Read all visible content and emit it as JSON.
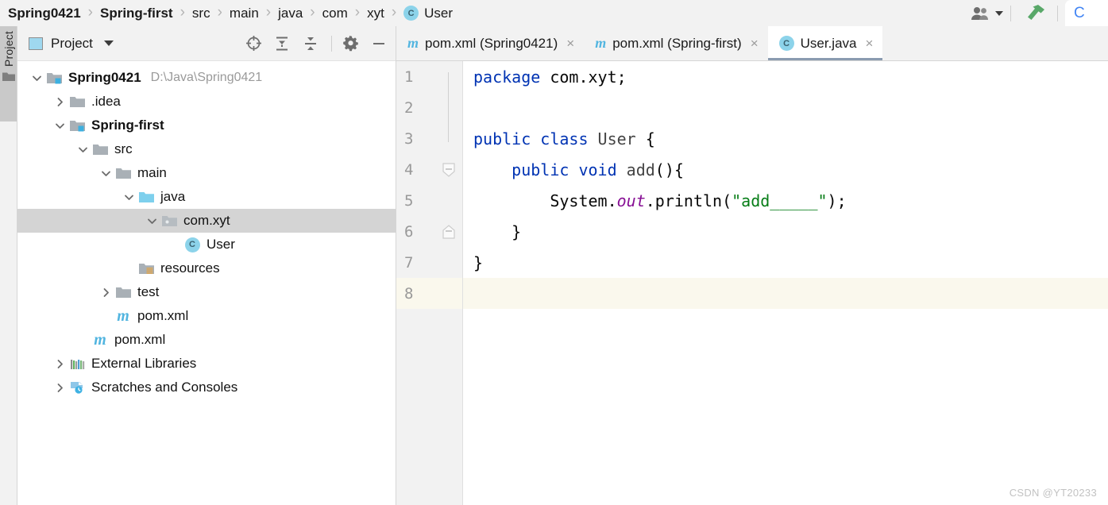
{
  "topbar": {
    "breadcrumb": [
      {
        "label": "Spring0421",
        "bold": true,
        "icon": null
      },
      {
        "label": "Spring-first",
        "bold": true,
        "icon": null
      },
      {
        "label": "src",
        "bold": false,
        "icon": null
      },
      {
        "label": "main",
        "bold": false,
        "icon": null
      },
      {
        "label": "java",
        "bold": false,
        "icon": null
      },
      {
        "label": "com",
        "bold": false,
        "icon": null
      },
      {
        "label": "xyt",
        "bold": false,
        "icon": null
      },
      {
        "label": "User",
        "bold": false,
        "icon": "class-icon",
        "icon_letter": "C"
      }
    ],
    "separator": "›",
    "people_icon": "people-icon",
    "dropdown_icon": "chevron-down-icon",
    "build_icon": "hammer-icon",
    "browser_letter": "C"
  },
  "stripe": {
    "label": "Project",
    "icon": "folder-icon"
  },
  "project_panel": {
    "title": "Project",
    "title_icon": "project-window-icon",
    "dropdown_icon": "chevron-down-icon",
    "tools": [
      {
        "name": "locate-icon",
        "tooltip": "Select Opened File"
      },
      {
        "name": "expand-all-icon",
        "tooltip": "Expand All"
      },
      {
        "name": "collapse-all-icon",
        "tooltip": "Collapse All"
      },
      {
        "name": "settings-gear-icon",
        "tooltip": "Settings"
      },
      {
        "name": "hide-icon",
        "tooltip": "Hide"
      }
    ],
    "tree": [
      {
        "label": "Spring0421",
        "path": "D:\\Java\\Spring0421",
        "indent": 0,
        "arrow": "down",
        "icon": "module-folder-icon",
        "bold": true,
        "selected": false
      },
      {
        "label": ".idea",
        "path": "",
        "indent": 1,
        "arrow": "right",
        "icon": "folder-icon",
        "bold": false,
        "selected": false
      },
      {
        "label": "Spring-first",
        "path": "",
        "indent": 1,
        "arrow": "down",
        "icon": "module-folder-icon",
        "bold": true,
        "selected": false
      },
      {
        "label": "src",
        "path": "",
        "indent": 2,
        "arrow": "down",
        "icon": "folder-icon",
        "bold": false,
        "selected": false
      },
      {
        "label": "main",
        "path": "",
        "indent": 3,
        "arrow": "down",
        "icon": "folder-icon",
        "bold": false,
        "selected": false
      },
      {
        "label": "java",
        "path": "",
        "indent": 4,
        "arrow": "down",
        "icon": "source-root-icon",
        "bold": false,
        "selected": false
      },
      {
        "label": "com.xyt",
        "path": "",
        "indent": 5,
        "arrow": "down",
        "icon": "package-icon",
        "bold": false,
        "selected": true
      },
      {
        "label": "User",
        "path": "",
        "indent": 6,
        "arrow": "none",
        "icon": "class-icon",
        "bold": false,
        "selected": false
      },
      {
        "label": "resources",
        "path": "",
        "indent": 4,
        "arrow": "none",
        "icon": "resources-folder-icon",
        "bold": false,
        "selected": false
      },
      {
        "label": "test",
        "path": "",
        "indent": 3,
        "arrow": "right",
        "icon": "folder-icon",
        "bold": false,
        "selected": false
      },
      {
        "label": "pom.xml",
        "path": "",
        "indent": 3,
        "arrow": "none",
        "icon": "maven-icon",
        "bold": false,
        "selected": false
      },
      {
        "label": "pom.xml",
        "path": "",
        "indent": 2,
        "arrow": "none",
        "icon": "maven-icon",
        "bold": false,
        "selected": false
      },
      {
        "label": "External Libraries",
        "path": "",
        "indent": 1,
        "arrow": "right",
        "icon": "libraries-icon",
        "bold": false,
        "selected": false
      },
      {
        "label": "Scratches and Consoles",
        "path": "",
        "indent": 1,
        "arrow": "right",
        "icon": "scratches-icon",
        "bold": false,
        "selected": false
      }
    ]
  },
  "editor": {
    "tabs": [
      {
        "label": "pom.xml (Spring0421)",
        "icon": "maven-icon",
        "active": false,
        "close": "×"
      },
      {
        "label": "pom.xml (Spring-first)",
        "icon": "maven-icon",
        "active": false,
        "close": "×"
      },
      {
        "label": "User.java",
        "icon": "class-icon",
        "active": true,
        "close": "×"
      }
    ],
    "line_numbers": [
      "1",
      "2",
      "3",
      "4",
      "5",
      "6",
      "7",
      "8"
    ],
    "caret_line": 8,
    "code": [
      {
        "n": "1",
        "tokens": [
          {
            "t": "package ",
            "c": "kw"
          },
          {
            "t": "com.xyt;",
            "c": "plain"
          }
        ]
      },
      {
        "n": "2",
        "tokens": []
      },
      {
        "n": "3",
        "tokens": [
          {
            "t": "public class ",
            "c": "kw"
          },
          {
            "t": "User ",
            "c": "ident"
          },
          {
            "t": "{",
            "c": "plain"
          }
        ]
      },
      {
        "n": "4",
        "tokens": [
          {
            "t": "    ",
            "c": "plain"
          },
          {
            "t": "public void ",
            "c": "kw"
          },
          {
            "t": "add",
            "c": "ident"
          },
          {
            "t": "(){",
            "c": "plain"
          }
        ]
      },
      {
        "n": "5",
        "tokens": [
          {
            "t": "        System.",
            "c": "plain"
          },
          {
            "t": "out",
            "c": "fld"
          },
          {
            "t": ".println(",
            "c": "plain"
          },
          {
            "t": "\"add_____\"",
            "c": "str"
          },
          {
            "t": ");",
            "c": "plain"
          }
        ]
      },
      {
        "n": "6",
        "tokens": [
          {
            "t": "    }",
            "c": "plain"
          }
        ]
      },
      {
        "n": "7",
        "tokens": [
          {
            "t": "}",
            "c": "plain"
          }
        ]
      },
      {
        "n": "8",
        "tokens": []
      }
    ],
    "fold_markers": [
      {
        "line": 4,
        "type": "collapse-start"
      },
      {
        "line": 6,
        "type": "collapse-end"
      }
    ]
  },
  "watermark": "CSDN @YT20233",
  "colors": {
    "keyword": "#0033b3",
    "string": "#067d17",
    "field": "#871094",
    "accent_blue": "#8cd3ea",
    "selection": "#d4d4d4",
    "caret_line": "#faf8ed",
    "toolbar_bg": "#f2f2f2",
    "build_green": "#59a869"
  }
}
